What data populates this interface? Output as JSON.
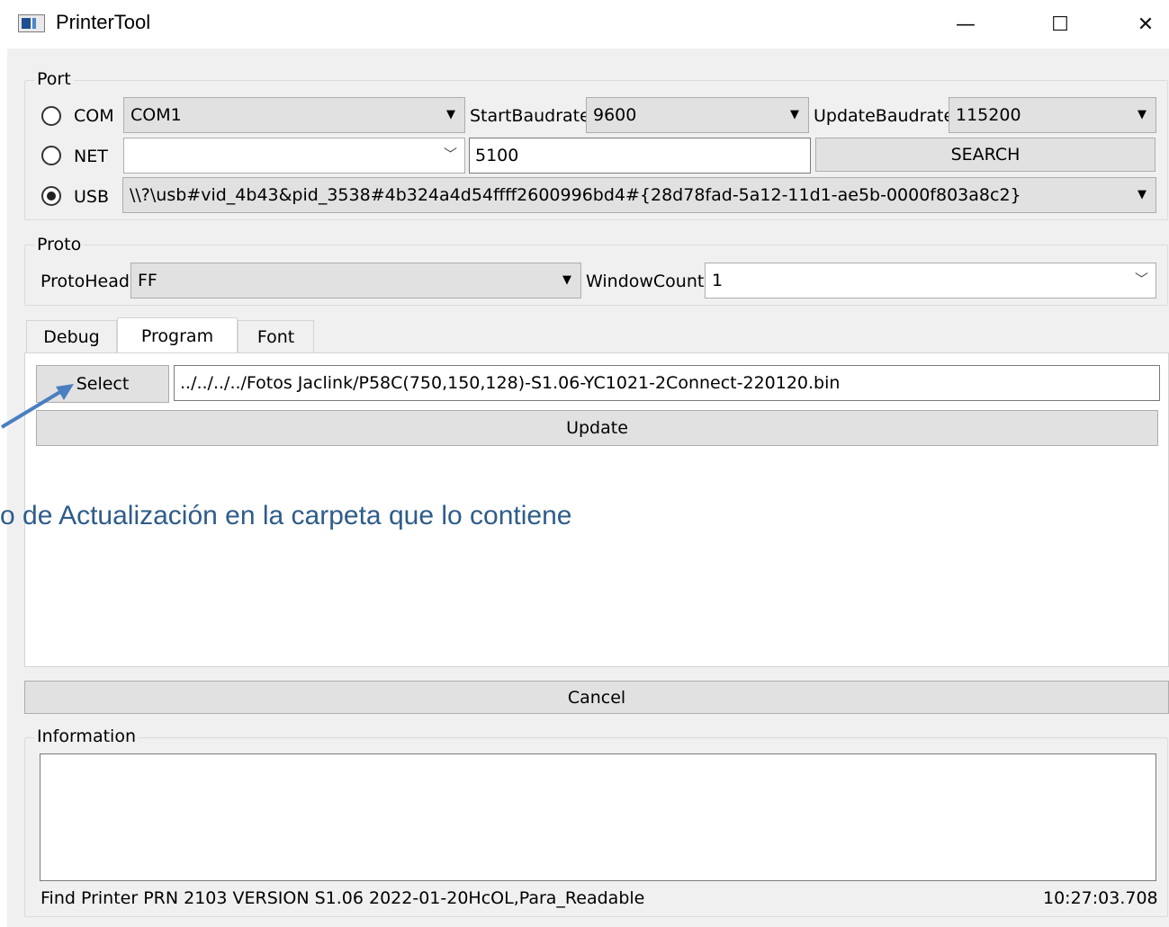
{
  "window": {
    "title": "PrinterTool",
    "minimize": "—",
    "maximize": "☐",
    "close": "✕"
  },
  "port": {
    "legend": "Port",
    "com": {
      "label": "COM",
      "value": "COM1"
    },
    "start_baudrate": {
      "label": "StartBaudrate",
      "value": "9600"
    },
    "update_baudrate": {
      "label": "UpdateBaudrate",
      "value": "115200"
    },
    "net": {
      "label": "NET",
      "value": "",
      "port_value": "5100"
    },
    "search_label": "SEARCH",
    "usb": {
      "label": "USB",
      "value": "\\\\?\\usb#vid_4b43&pid_3538#4b324a4d54ffff2600996bd4#{28d78fad-5a12-11d1-ae5b-0000f803a8c2}"
    }
  },
  "proto": {
    "legend": "Proto",
    "proto_head": {
      "label": "ProtoHead",
      "value": "FF"
    },
    "window_count": {
      "label": "WindowCount",
      "value": "1"
    }
  },
  "tabs": {
    "debug": "Debug",
    "program": "Program",
    "font": "Font"
  },
  "program": {
    "select_label": "Select",
    "file_path": "../../../../Fotos Jaclink/P58C(750,150,128)-S1.06-YC1021-2Connect-220120.bin",
    "update_label": "Update"
  },
  "overlay_text": "o de Actualización en la carpeta que lo contiene",
  "cancel_label": "Cancel",
  "information": {
    "legend": "Information",
    "status_text": "Find Printer PRN 2103  VERSION S1.06 2022-01-20HcOL,Para_Readable",
    "timestamp": "10:27:03.708"
  },
  "colors": {
    "overlay_text": "#2e5c8a",
    "arrow": "#4a7fc1"
  },
  "icons": {
    "dropdown": "▼",
    "chevron": "﹀"
  }
}
